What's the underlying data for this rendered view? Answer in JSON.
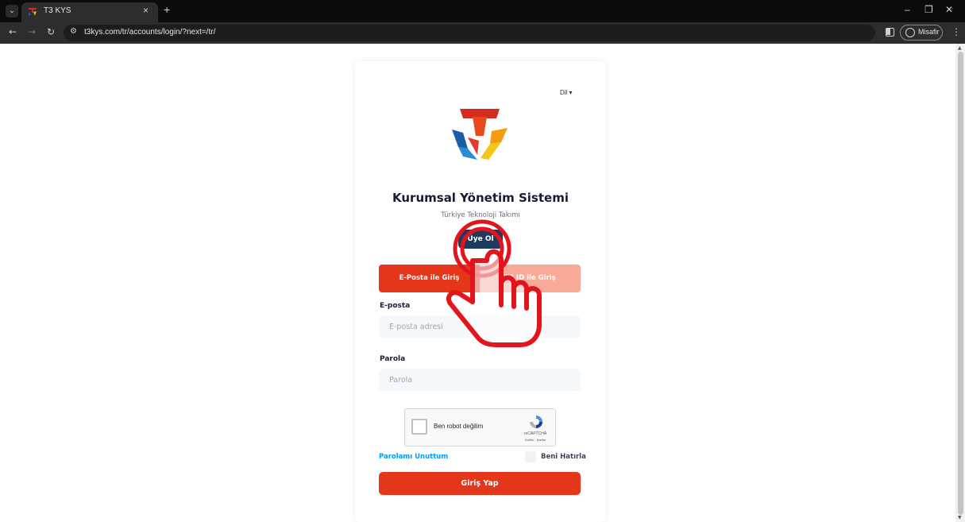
{
  "browser": {
    "tab_title": "T3 KYS",
    "tab_close": "×",
    "new_tab": "+",
    "url": "t3kys.com/tr/accounts/login/?next=/tr/",
    "profile_label": "Misafir",
    "back_icon": "arrow-left-icon",
    "forward_icon": "arrow-right-icon",
    "reload_icon": "reload-icon"
  },
  "page": {
    "language_label": "Dil ▾",
    "title": "Kurumsal Yönetim Sistemi",
    "subtitle": "Türkiye Teknoloji Takımı",
    "signup_label": "Üye Ol",
    "tabs": [
      {
        "label": "E-Posta ile Giriş",
        "active": true
      },
      {
        "label": "T3 ID ile Giriş",
        "active": false
      }
    ],
    "email_label": "E-posta",
    "email_placeholder": "E-posta adresi",
    "password_label": "Parola",
    "password_placeholder": "Parola",
    "captcha": {
      "label": "Ben robot değilim",
      "brand": "reCAPTCHA",
      "links": "Gizlilik - Şartlar"
    },
    "forgot_password": "Parolamı Unuttum",
    "remember_me": "Beni Hatırla",
    "login_button": "Giriş Yap"
  },
  "colors": {
    "primary_red": "#e4361a",
    "inactive_tab": "#f8a998",
    "signup_navy": "#1e3a5f",
    "link_blue": "#009ef7",
    "annotation_red": "#e4141e"
  }
}
